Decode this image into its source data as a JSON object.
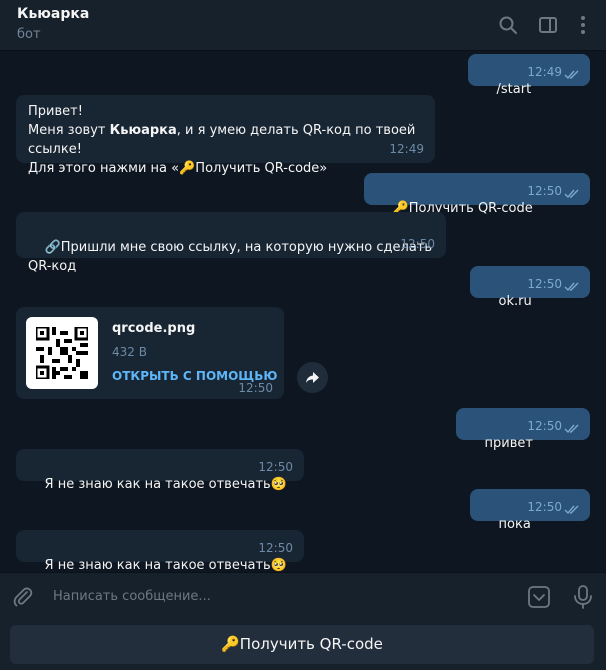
{
  "header": {
    "title": "Кьюарка",
    "subtitle": "бот"
  },
  "messages": [
    {
      "dir": "out",
      "text": "/start",
      "time": "12:49"
    },
    {
      "dir": "in",
      "line1": "Привет!",
      "line2_a": "Меня зовут ",
      "line2_bold": "Кьюарка",
      "line2_b": ", и я умею делать QR-код по твоей ссылке!",
      "line3": "Для этого нажми на «🔑Получить QR-code»",
      "time": "12:49"
    },
    {
      "dir": "out",
      "text": "🔑Получить QR-code",
      "time": "12:50"
    },
    {
      "dir": "in",
      "text": "🔗Пришли мне свою ссылку, на которую нужно сделать QR-код",
      "time": "12:50"
    },
    {
      "dir": "out",
      "text": "ok.ru",
      "time": "12:50"
    },
    {
      "dir": "out",
      "text": "привет",
      "time": "12:50"
    },
    {
      "dir": "in",
      "text": "Я не знаю как на такое отвечать🥺",
      "time": "12:50"
    },
    {
      "dir": "out",
      "text": "пока",
      "time": "12:50"
    },
    {
      "dir": "in",
      "text": "Я не знаю как на такое отвечать🥺",
      "time": "12:50"
    }
  ],
  "file": {
    "name": "qrcode.png",
    "size": "432 B",
    "open_label": "ОТКРЫТЬ С ПОМОЩЬЮ",
    "time": "12:50"
  },
  "composer": {
    "placeholder": "Написать сообщение..."
  },
  "keyboard": {
    "button_label": "🔑Получить QR-code"
  },
  "colors": {
    "background": "#0e1621",
    "panel": "#17212b",
    "incoming": "#182533",
    "outgoing": "#2b5278",
    "accent": "#5eb5f7"
  },
  "icons": [
    "search-icon",
    "sidebar-toggle-icon",
    "more-vertical-icon",
    "double-check-icon",
    "forward-icon",
    "attach-icon",
    "bot-keyboard-icon",
    "microphone-icon"
  ]
}
